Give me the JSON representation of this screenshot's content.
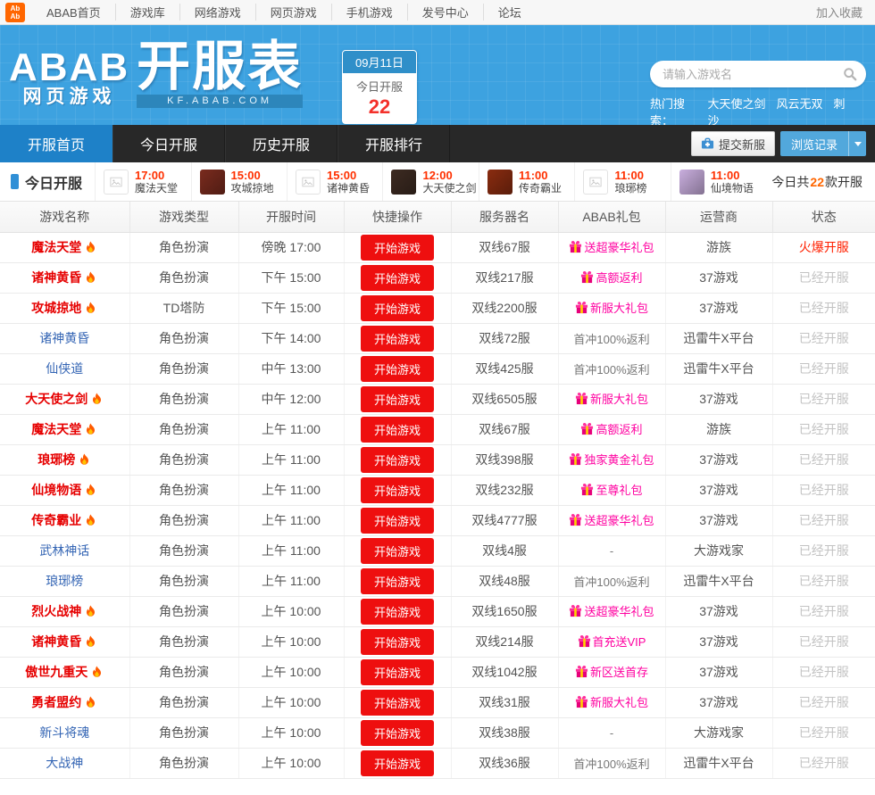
{
  "colors": {
    "header_blue": "#3da2e0",
    "accent_blue": "#1e81c8",
    "dark_bar": "#282828",
    "button_red": "#ee0f0f",
    "gift_pink": "#ff00a0",
    "count_orange": "#ff6600",
    "link_blue": "#3465b4",
    "hot_red": "#e60000"
  },
  "topbar": {
    "logo_lines": [
      "Ab",
      "Ab"
    ],
    "items": [
      {
        "label": "ABAB首页"
      },
      {
        "label": "游戏库"
      },
      {
        "label": "网络游戏"
      },
      {
        "label": "网页游戏"
      },
      {
        "label": "手机游戏"
      },
      {
        "label": "发号中心"
      },
      {
        "label": "论坛"
      }
    ],
    "favorite": "加入收藏"
  },
  "header": {
    "logo_main": "ABAB",
    "logo_sub": "网页游戏",
    "logo_big": "开服表",
    "logo_domain": "KF.ABAB.COM",
    "date_box": {
      "date": "09月11日",
      "label": "今日开服",
      "count": "22"
    },
    "search_placeholder": "请输入游戏名",
    "hot_label": "热门搜索：",
    "hot_links": [
      "大天使之剑",
      "风云无双",
      "刺沙"
    ]
  },
  "tabs": {
    "items": [
      {
        "label": "开服首页",
        "active": true
      },
      {
        "label": "今日开服",
        "active": false
      },
      {
        "label": "历史开服",
        "active": false
      },
      {
        "label": "开服排行",
        "active": false
      }
    ],
    "submit_label": "提交新服",
    "history_label": "浏览记录"
  },
  "ticker": {
    "title": "今日开服",
    "items": [
      {
        "time": "17:00",
        "name": "魔法天堂",
        "thumb": "#ededed",
        "broken": true
      },
      {
        "time": "15:00",
        "name": "攻城掠地",
        "thumb": "#7a2b1e",
        "broken": false
      },
      {
        "time": "15:00",
        "name": "诸神黄昏",
        "thumb": "#ededed",
        "broken": true
      },
      {
        "time": "12:00",
        "name": "大天使之剑",
        "thumb": "#3d2b22",
        "broken": false
      },
      {
        "time": "11:00",
        "name": "传奇霸业",
        "thumb": "#8a2c10",
        "broken": false
      },
      {
        "time": "11:00",
        "name": "琅琊榜",
        "thumb": "#f2f2f2",
        "broken": true
      },
      {
        "time": "11:00",
        "name": "仙境物语",
        "thumb": "#c9aede",
        "broken": false
      }
    ],
    "summary": {
      "prefix": "今日共",
      "count": "22",
      "suffix": "款开服"
    }
  },
  "table": {
    "headers": [
      "游戏名称",
      "游戏类型",
      "开服时间",
      "快捷操作",
      "服务器名",
      "ABAB礼包",
      "运营商",
      "状态"
    ],
    "start_label": "开始游戏",
    "rows": [
      {
        "name": "魔法天堂",
        "hot": true,
        "type": "角色扮演",
        "time": "傍晚 17:00",
        "server": "双线67服",
        "gift": "送超豪华礼包",
        "gift_icon": true,
        "operator": "游族",
        "status": "火爆开服",
        "status_hot": true
      },
      {
        "name": "诸神黄昏",
        "hot": true,
        "type": "角色扮演",
        "time": "下午 15:00",
        "server": "双线217服",
        "gift": "高额返利",
        "gift_icon": true,
        "operator": "37游戏",
        "status": "已经开服",
        "status_hot": false
      },
      {
        "name": "攻城掠地",
        "hot": true,
        "type": "TD塔防",
        "time": "下午 15:00",
        "server": "双线2200服",
        "gift": "新服大礼包",
        "gift_icon": true,
        "operator": "37游戏",
        "status": "已经开服",
        "status_hot": false
      },
      {
        "name": "诸神黄昏",
        "hot": false,
        "type": "角色扮演",
        "time": "下午 14:00",
        "server": "双线72服",
        "gift": "首冲100%返利",
        "gift_icon": false,
        "operator": "迅雷牛X平台",
        "status": "已经开服",
        "status_hot": false
      },
      {
        "name": "仙侠道",
        "hot": false,
        "type": "角色扮演",
        "time": "中午 13:00",
        "server": "双线425服",
        "gift": "首冲100%返利",
        "gift_icon": false,
        "operator": "迅雷牛X平台",
        "status": "已经开服",
        "status_hot": false
      },
      {
        "name": "大天使之剑",
        "hot": true,
        "type": "角色扮演",
        "time": "中午 12:00",
        "server": "双线6505服",
        "gift": "新服大礼包",
        "gift_icon": true,
        "operator": "37游戏",
        "status": "已经开服",
        "status_hot": false
      },
      {
        "name": "魔法天堂",
        "hot": true,
        "type": "角色扮演",
        "time": "上午 11:00",
        "server": "双线67服",
        "gift": "高额返利",
        "gift_icon": true,
        "operator": "游族",
        "status": "已经开服",
        "status_hot": false
      },
      {
        "name": "琅琊榜",
        "hot": true,
        "type": "角色扮演",
        "time": "上午 11:00",
        "server": "双线398服",
        "gift": "独家黄金礼包",
        "gift_icon": true,
        "operator": "37游戏",
        "status": "已经开服",
        "status_hot": false
      },
      {
        "name": "仙境物语",
        "hot": true,
        "type": "角色扮演",
        "time": "上午 11:00",
        "server": "双线232服",
        "gift": "至尊礼包",
        "gift_icon": true,
        "operator": "37游戏",
        "status": "已经开服",
        "status_hot": false
      },
      {
        "name": "传奇霸业",
        "hot": true,
        "type": "角色扮演",
        "time": "上午 11:00",
        "server": "双线4777服",
        "gift": "送超豪华礼包",
        "gift_icon": true,
        "operator": "37游戏",
        "status": "已经开服",
        "status_hot": false
      },
      {
        "name": "武林神话",
        "hot": false,
        "type": "角色扮演",
        "time": "上午 11:00",
        "server": "双线4服",
        "gift": "-",
        "gift_icon": false,
        "operator": "大游戏家",
        "status": "已经开服",
        "status_hot": false
      },
      {
        "name": "琅琊榜",
        "hot": false,
        "type": "角色扮演",
        "time": "上午 11:00",
        "server": "双线48服",
        "gift": "首冲100%返利",
        "gift_icon": false,
        "operator": "迅雷牛X平台",
        "status": "已经开服",
        "status_hot": false
      },
      {
        "name": "烈火战神",
        "hot": true,
        "type": "角色扮演",
        "time": "上午 10:00",
        "server": "双线1650服",
        "gift": "送超豪华礼包",
        "gift_icon": true,
        "operator": "37游戏",
        "status": "已经开服",
        "status_hot": false
      },
      {
        "name": "诸神黄昏",
        "hot": true,
        "type": "角色扮演",
        "time": "上午 10:00",
        "server": "双线214服",
        "gift": "首充送VIP",
        "gift_icon": true,
        "operator": "37游戏",
        "status": "已经开服",
        "status_hot": false
      },
      {
        "name": "傲世九重天",
        "hot": true,
        "type": "角色扮演",
        "time": "上午 10:00",
        "server": "双线1042服",
        "gift": "新区送首存",
        "gift_icon": true,
        "operator": "37游戏",
        "status": "已经开服",
        "status_hot": false
      },
      {
        "name": "勇者盟约",
        "hot": true,
        "type": "角色扮演",
        "time": "上午 10:00",
        "server": "双线31服",
        "gift": "新服大礼包",
        "gift_icon": true,
        "operator": "37游戏",
        "status": "已经开服",
        "status_hot": false
      },
      {
        "name": "新斗将魂",
        "hot": false,
        "type": "角色扮演",
        "time": "上午 10:00",
        "server": "双线38服",
        "gift": "-",
        "gift_icon": false,
        "operator": "大游戏家",
        "status": "已经开服",
        "status_hot": false
      },
      {
        "name": "大战神",
        "hot": false,
        "type": "角色扮演",
        "time": "上午 10:00",
        "server": "双线36服",
        "gift": "首冲100%返利",
        "gift_icon": false,
        "operator": "迅雷牛X平台",
        "status": "已经开服",
        "status_hot": false
      }
    ]
  }
}
